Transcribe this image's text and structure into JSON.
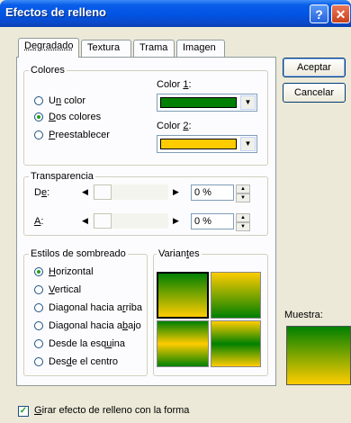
{
  "window": {
    "title": "Efectos de relleno",
    "help_glyph": "?",
    "close_glyph": "✕"
  },
  "tabs": [
    "Degradado",
    "Textura",
    "Trama",
    "Imagen"
  ],
  "active_tab": "Degradado",
  "colores": {
    "legend": "Colores",
    "options": [
      {
        "pre": "U",
        "key": "n",
        "post": " color",
        "checked": false
      },
      {
        "pre": "",
        "key": "D",
        "post": "os colores",
        "checked": true
      },
      {
        "pre": "",
        "key": "P",
        "post": "reestablecer",
        "checked": false
      }
    ],
    "color1": {
      "pre": "Color ",
      "key": "1",
      "post": ":",
      "value": "#008000"
    },
    "color2": {
      "pre": "Color ",
      "key": "2",
      "post": ":",
      "value": "#ffcc00"
    }
  },
  "transparencia": {
    "legend": "Transparencia",
    "de": {
      "pre": "D",
      "key": "e",
      "post": ":",
      "value": "0 %"
    },
    "a": {
      "pre": "",
      "key": "A",
      "post": ":",
      "value": "0 %"
    }
  },
  "estilos": {
    "legend": "Estilos de sombreado",
    "options": [
      {
        "pre": "",
        "key": "H",
        "post": "orizontal",
        "checked": true
      },
      {
        "pre": "",
        "key": "V",
        "post": "ertical",
        "checked": false
      },
      {
        "pre": "Diagonal hacia a",
        "key": "r",
        "post": "riba",
        "checked": false
      },
      {
        "pre": "Diagonal hacia a",
        "key": "b",
        "post": "ajo",
        "checked": false
      },
      {
        "pre": "Desde la esq",
        "key": "u",
        "post": "ina",
        "checked": false
      },
      {
        "pre": "Des",
        "key": "d",
        "post": "e el centro",
        "checked": false
      }
    ]
  },
  "variantes": {
    "pre": "Varian",
    "key": "t",
    "post": "es"
  },
  "buttons": {
    "ok": "Aceptar",
    "cancel": "Cancelar"
  },
  "muestra": {
    "label": "Muestra:"
  },
  "rotate": {
    "label": "Girar efecto de relleno con la forma",
    "checked": true
  },
  "colors": {
    "green": "#008000",
    "yellow": "#ffcc00",
    "accent": "#0054e3"
  }
}
